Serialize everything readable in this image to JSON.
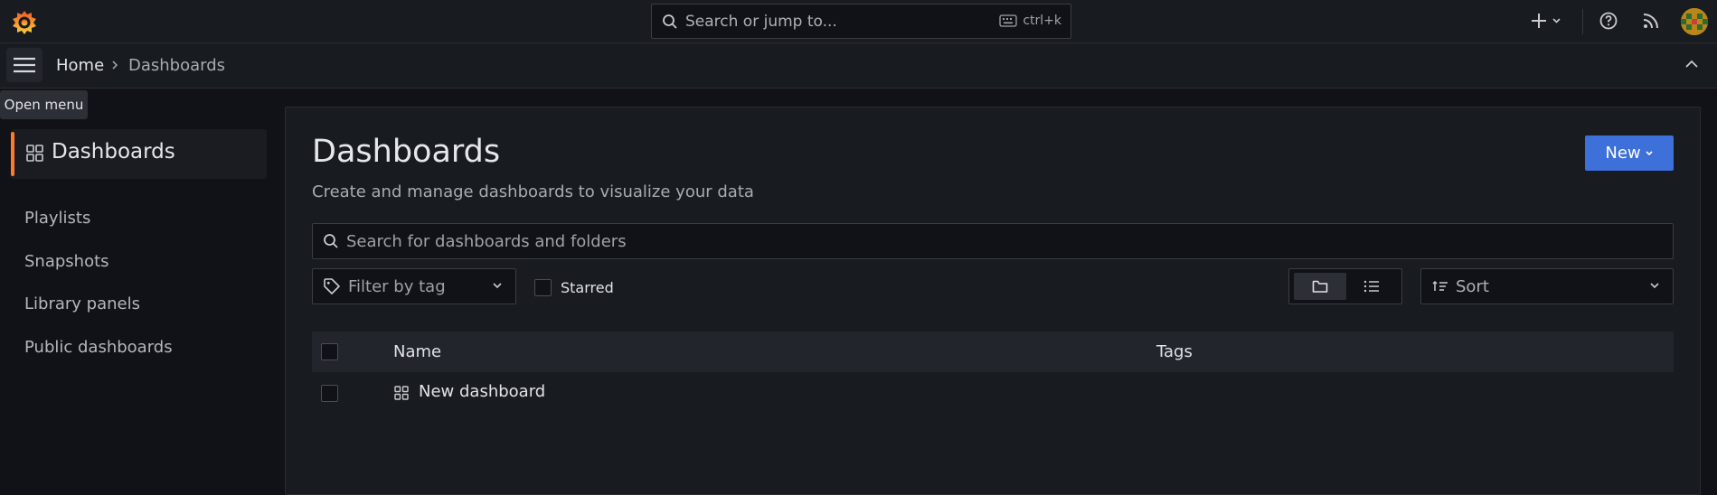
{
  "topbar": {
    "logo": "grafana-logo",
    "search_placeholder": "Search or jump to...",
    "shortcut": "ctrl+k"
  },
  "breadcrumb": {
    "home": "Home",
    "current": "Dashboards"
  },
  "tooltip": "Open menu",
  "sidebar": {
    "active": "Dashboards",
    "items": [
      {
        "label": "Playlists"
      },
      {
        "label": "Snapshots"
      },
      {
        "label": "Library panels"
      },
      {
        "label": "Public dashboards"
      }
    ]
  },
  "main": {
    "title": "Dashboards",
    "subtitle": "Create and manage dashboards to visualize your data",
    "new_button": "New",
    "search_placeholder": "Search for dashboards and folders",
    "tag_filter_placeholder": "Filter by tag",
    "starred_label": "Starred",
    "sort_label": "Sort",
    "table": {
      "columns": [
        "Name",
        "Tags"
      ],
      "rows": [
        {
          "name": "New dashboard",
          "tags": ""
        }
      ]
    }
  },
  "colors": {
    "accent": "#3d71d9",
    "active_indicator": "#ff7a2a",
    "background": "#111217",
    "panel": "#181b1f"
  }
}
